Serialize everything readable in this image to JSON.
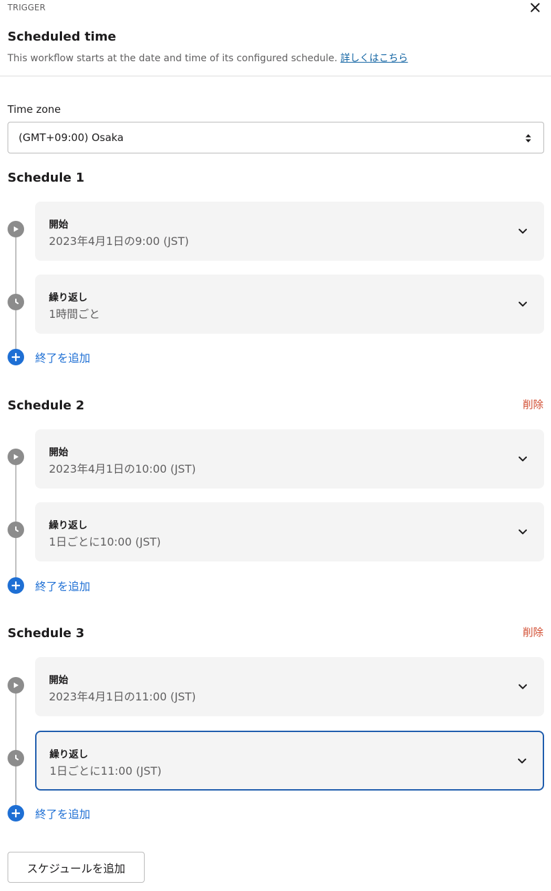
{
  "header": {
    "trigger_label": "TRIGGER",
    "title": "Scheduled time",
    "description": "This workflow starts at the date and time of its configured schedule.",
    "learn_more": "詳しくはこちら"
  },
  "timezone": {
    "label": "Time zone",
    "value": "(GMT+09:00) Osaka"
  },
  "schedules": [
    {
      "title": "Schedule 1",
      "delete_label": "",
      "start": {
        "label": "開始",
        "value": "2023年4月1日の9:00 (JST)"
      },
      "repeat": {
        "label": "繰り返し",
        "value": "1時間ごと"
      },
      "add_end": "終了を追加"
    },
    {
      "title": "Schedule 2",
      "delete_label": "削除",
      "start": {
        "label": "開始",
        "value": "2023年4月1日の10:00 (JST)"
      },
      "repeat": {
        "label": "繰り返し",
        "value": "1日ごとに10:00 (JST)"
      },
      "add_end": "終了を追加"
    },
    {
      "title": "Schedule 3",
      "delete_label": "削除",
      "start": {
        "label": "開始",
        "value": "2023年4月1日の11:00 (JST)"
      },
      "repeat": {
        "label": "繰り返し",
        "value": "1日ごとに11:00 (JST)"
      },
      "add_end": "終了を追加"
    }
  ],
  "footer": {
    "add_schedule": "スケジュールを追加"
  },
  "colors": {
    "link": "#1264a3",
    "accent_blue": "#1e6fd4",
    "delete_red": "#d14a2e",
    "focus_border": "#1e5cad",
    "card_bg": "#f4f4f4",
    "timeline_gray": "#8c8c8c"
  },
  "icons": {
    "close": "close-icon",
    "select": "updown-arrows-icon",
    "start": "play-icon",
    "repeat": "clock-icon",
    "expand": "chevron-down-icon",
    "add": "plus-icon"
  }
}
